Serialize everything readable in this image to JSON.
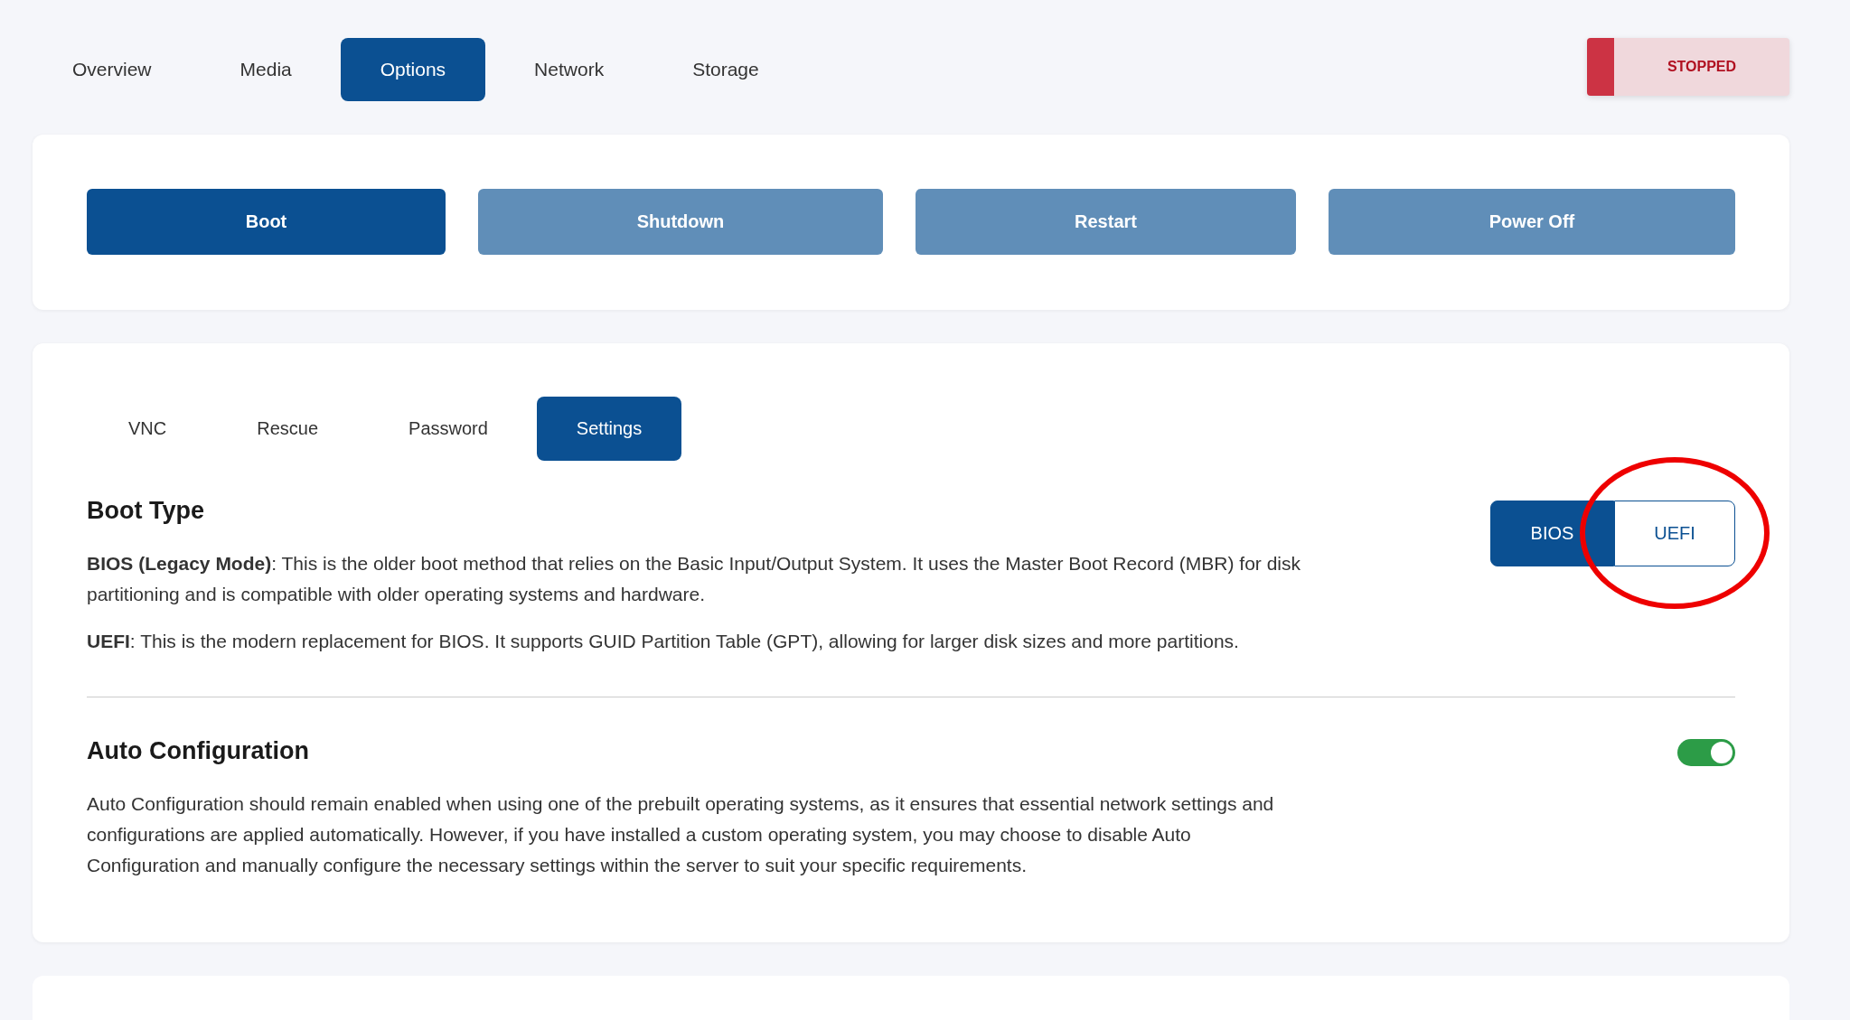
{
  "tabs": [
    {
      "label": "Overview",
      "selected": false
    },
    {
      "label": "Media",
      "selected": false
    },
    {
      "label": "Options",
      "selected": true
    },
    {
      "label": "Network",
      "selected": false
    },
    {
      "label": "Storage",
      "selected": false
    }
  ],
  "status": {
    "label": "STOPPED",
    "kind": "stopped"
  },
  "actions": [
    {
      "label": "Boot",
      "disabled": false
    },
    {
      "label": "Shutdown",
      "disabled": true
    },
    {
      "label": "Restart",
      "disabled": true
    },
    {
      "label": "Power Off",
      "disabled": true
    }
  ],
  "subtabs": [
    {
      "label": "VNC",
      "selected": false
    },
    {
      "label": "Rescue",
      "selected": false
    },
    {
      "label": "Password",
      "selected": false
    },
    {
      "label": "Settings",
      "selected": true
    }
  ],
  "boot_type": {
    "title": "Boot Type",
    "paragraphs": [
      "**BIOS (Legacy Mode)**: This is the older boot method that relies on the Basic Input/Output System. It uses the Master Boot Record (MBR) for disk partitioning and is compatible with older operating systems and hardware.",
      "**UEFI**: This is the modern replacement for BIOS. It supports GUID Partition Table (GPT), allowing for larger disk sizes and more partitions."
    ],
    "options": [
      {
        "label": "BIOS",
        "selected": true
      },
      {
        "label": "UEFI",
        "selected": false
      }
    ],
    "annotation_circle": true
  },
  "auto_configuration": {
    "title": "Auto Configuration",
    "on": true,
    "paragraphs": [
      "Auto Configuration should remain enabled when using one of the prebuilt operating systems, as it ensures that essential network settings and configurations are applied automatically. However, if you have installed a custom operating system, you may choose to disable Auto Configuration and manually configure the necessary settings within the server to suit your specific requirements."
    ]
  }
}
